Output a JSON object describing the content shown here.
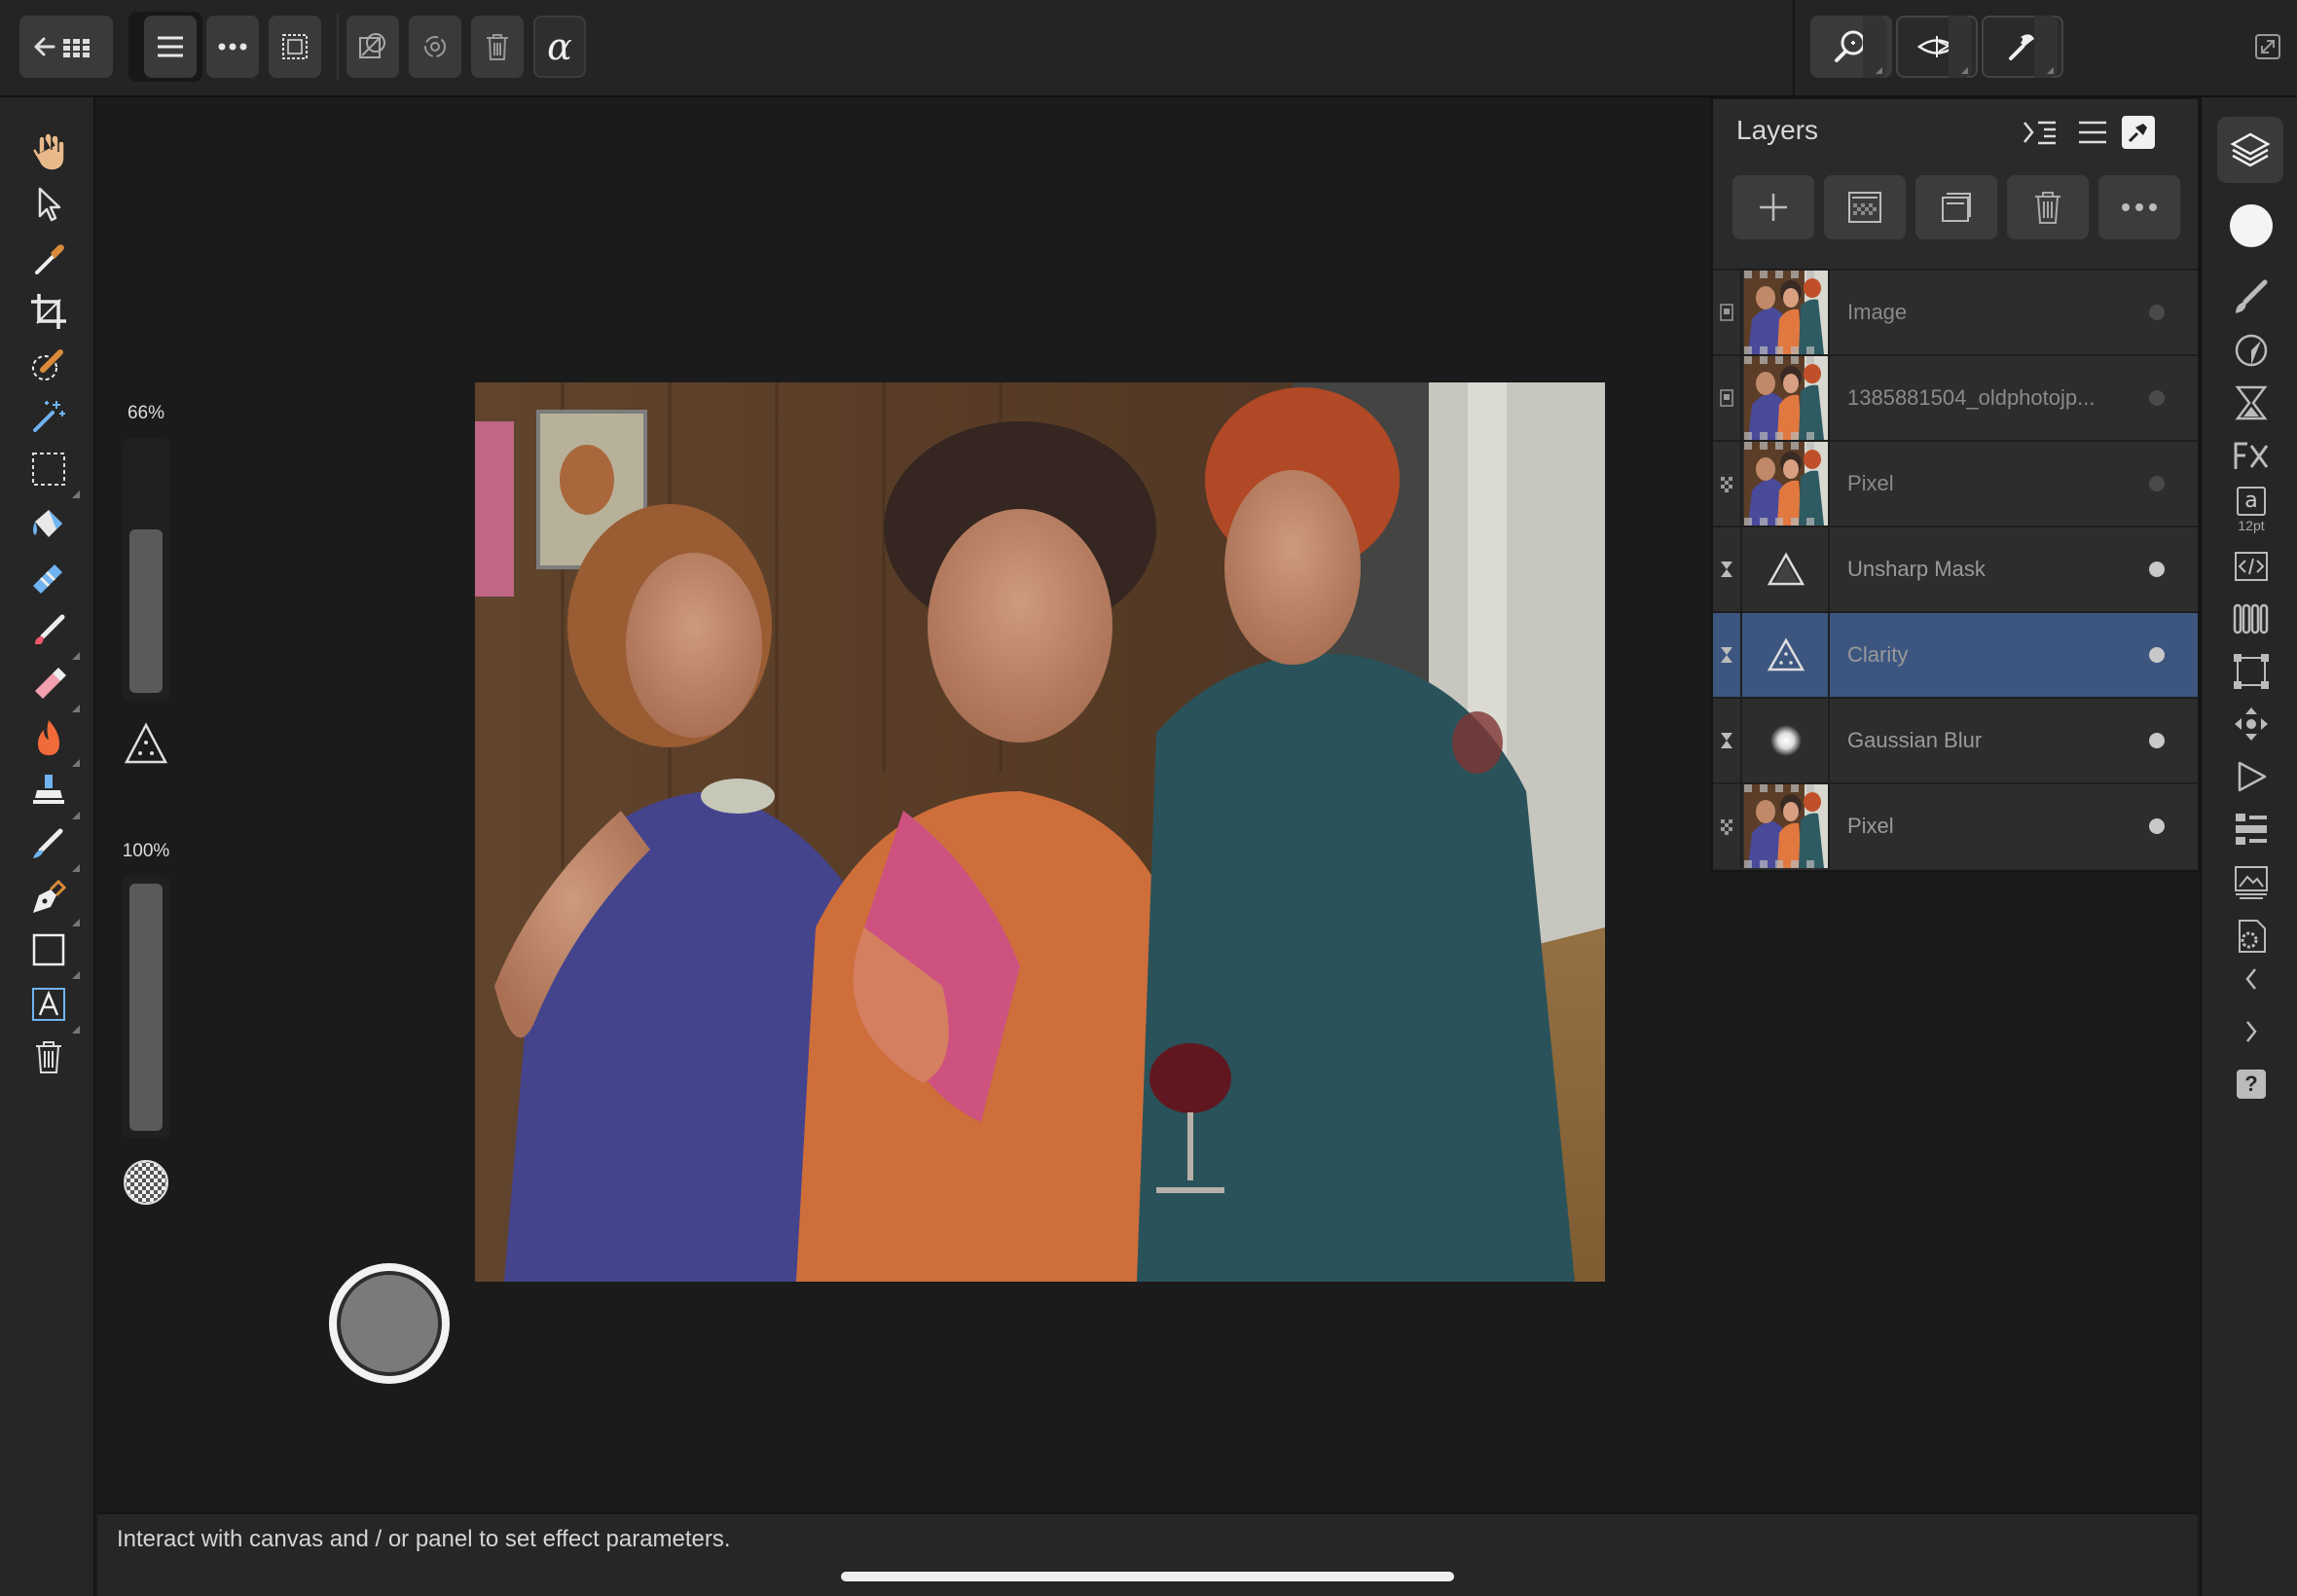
{
  "toolbar": {
    "buttons": [
      "back-to-gallery",
      "persona-photo",
      "menu",
      "more",
      "selection",
      "quick-mask",
      "refine",
      "delete",
      "alpha"
    ],
    "alpha_label": "α",
    "right_buttons": [
      "zoom",
      "view-mode",
      "assistant",
      "fullscreen"
    ]
  },
  "left_tools": [
    "view-hand",
    "move",
    "color-picker",
    "crop",
    "selection-brush",
    "flood-select",
    "marquee",
    "flood-fill",
    "gradient",
    "paint-brush",
    "erase",
    "dodge",
    "clone",
    "smudge",
    "pen",
    "rectangle",
    "artistic-text",
    "delete"
  ],
  "context": {
    "opacity_label": "66%",
    "opacity_value": 0.66,
    "flow_label": "100%",
    "flow_value": 1.0
  },
  "layers_panel": {
    "title": "Layers",
    "action_buttons": [
      "add-layer",
      "mask-layer",
      "group-layer",
      "delete-layer",
      "more-options"
    ],
    "layers": [
      {
        "name": "Image",
        "type": "image",
        "thumb": "photo",
        "visible": false,
        "selected": false
      },
      {
        "name": "1385881504_oldphotojp...",
        "type": "image",
        "thumb": "photo",
        "visible": false,
        "selected": false
      },
      {
        "name": "Pixel",
        "type": "pixel",
        "thumb": "photo",
        "visible": false,
        "selected": false
      },
      {
        "name": "Unsharp Mask",
        "type": "live-filter",
        "thumb": "triangle",
        "visible": true,
        "selected": false
      },
      {
        "name": "Clarity",
        "type": "live-filter",
        "thumb": "triangle-dots",
        "visible": true,
        "selected": true
      },
      {
        "name": "Gaussian Blur",
        "type": "live-filter",
        "thumb": "blur-dot",
        "visible": true,
        "selected": false
      },
      {
        "name": "Pixel",
        "type": "pixel",
        "thumb": "photo",
        "visible": true,
        "selected": false
      }
    ]
  },
  "right_studio": {
    "items": [
      "layers",
      "color",
      "brushes",
      "adjustments",
      "live-filters",
      "effects",
      "character",
      "text-styles",
      "swatches",
      "transform",
      "navigator",
      "macros",
      "history",
      "channels",
      "preferences",
      "collapse-left",
      "collapse-right",
      "help"
    ],
    "character_label": "a",
    "character_size": "12pt",
    "help_label": "?"
  },
  "status": {
    "text": "Interact with canvas and / or panel to set effect parameters."
  },
  "colors": {
    "accent_selected": "#3c5680",
    "panel_bg": "#2a2a2a",
    "persona_purple": "#8a4de0"
  }
}
